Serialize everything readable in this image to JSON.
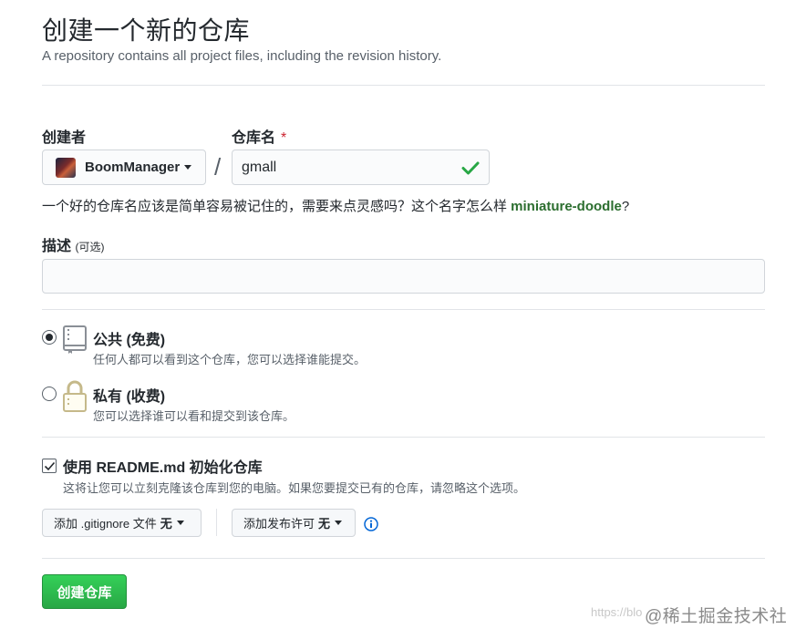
{
  "header": {
    "title": "创建一个新的仓库",
    "subtitle": "A repository contains all project files, including the revision history."
  },
  "owner": {
    "label": "创建者",
    "value": "BoomManager"
  },
  "separator": "/",
  "repo_name": {
    "label": "仓库名",
    "required_mark": "*",
    "value": "gmall"
  },
  "name_hint": {
    "text": "一个好的仓库名应该是简单容易被记住的，需要来点灵感吗？这个名字怎么样 ",
    "suggestion": "miniature-doodle",
    "suffix": "?"
  },
  "description": {
    "label": "描述",
    "optional": "(可选)",
    "value": ""
  },
  "visibility": {
    "public": {
      "title": "公共 (免费)",
      "desc": "任何人都可以看到这个仓库，您可以选择谁能提交。",
      "checked": true
    },
    "private": {
      "title": "私有 (收费)",
      "desc": "您可以选择谁可以看和提交到该仓库。",
      "checked": false
    }
  },
  "readme": {
    "label": "使用 README.md 初始化仓库",
    "desc": "这将让您可以立刻克隆该仓库到您的电脑。如果您要提交已有的仓库，请忽略这个选项。",
    "checked": true
  },
  "gitignore": {
    "label": "添加 .gitignore 文件",
    "value": "无"
  },
  "license": {
    "label": "添加发布许可",
    "value": "无"
  },
  "submit": {
    "label": "创建仓库"
  },
  "watermark": {
    "url": "https://blo",
    "text": "@稀土掘金技术社区"
  },
  "colors": {
    "accent_green": "#28a745",
    "suggestion_green": "#2c6e2f",
    "info_blue": "#0366d6",
    "required_red": "#cb2431"
  }
}
